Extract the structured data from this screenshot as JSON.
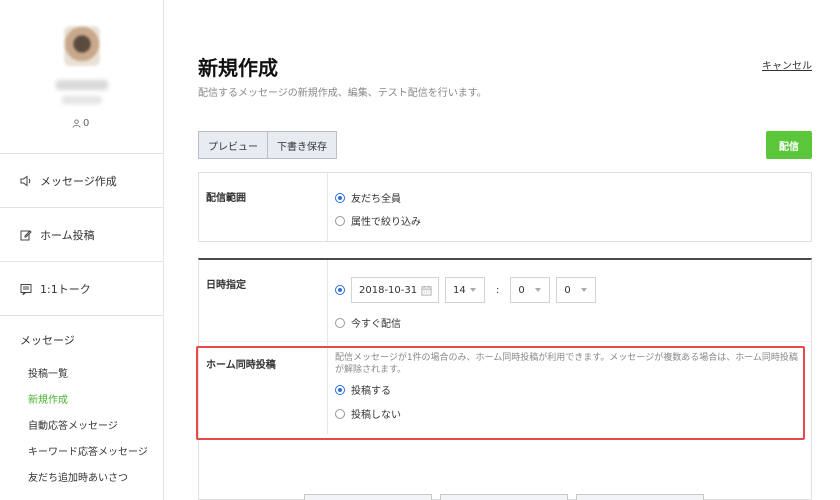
{
  "sidebar": {
    "follower_count": "0",
    "nav": [
      {
        "label": "メッセージ作成",
        "icon": "speaker-icon"
      },
      {
        "label": "ホーム投稿",
        "icon": "edit-icon"
      },
      {
        "label": "1:1トーク",
        "icon": "chat-icon"
      }
    ],
    "menu_heading": "メッセージ",
    "menu": [
      {
        "label": "投稿一覧"
      },
      {
        "label": "新規作成"
      },
      {
        "label": "自動応答メッセージ"
      },
      {
        "label": "キーワード応答メッセージ"
      },
      {
        "label": "友だち追加時あいさつ"
      }
    ]
  },
  "main": {
    "title": "新規作成",
    "description": "配信するメッセージの新規作成、編集、テスト配信を行います。",
    "cancel_label": "キャンセル",
    "preview_label": "プレビュー",
    "draft_label": "下書き保存",
    "send_label": "配信"
  },
  "audience": {
    "label": "配信範囲",
    "options": [
      "友だち全員",
      "属性で絞り込み"
    ],
    "selected": 0
  },
  "schedule": {
    "label": "日時指定",
    "date": "2018-10-31",
    "hour": "14",
    "colon": ":",
    "minute": "0",
    "second": "0",
    "now_label": "今すぐ配信"
  },
  "home_post": {
    "label": "ホーム同時投稿",
    "note": "配信メッセージが1件の場合のみ、ホーム同時投稿が利用できます。メッセージが複数ある場合は、ホーム同時投稿が解除されます。",
    "options": [
      "投稿する",
      "投稿しない"
    ],
    "selected": 0
  },
  "colors": {
    "accent_green": "#5ac63a",
    "active_menu": "#48b332",
    "radio_blue": "#2f6fd6",
    "highlight_red": "#e84a4a"
  }
}
